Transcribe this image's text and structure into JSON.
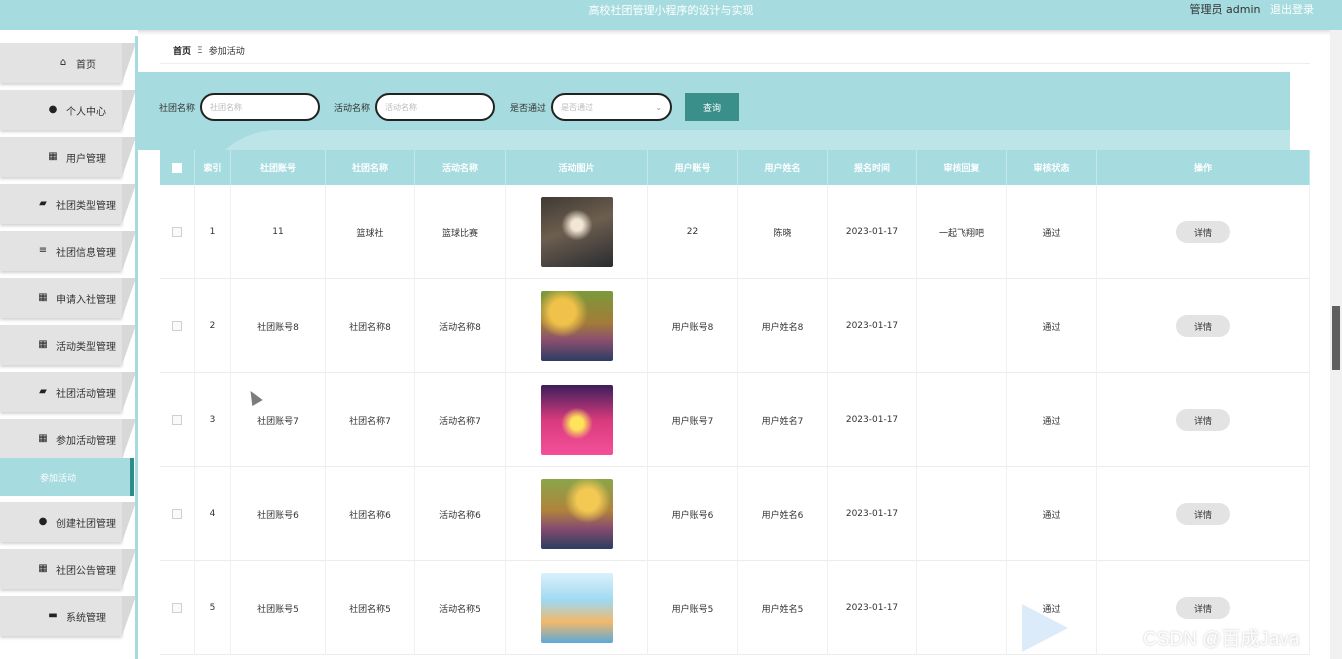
{
  "header": {
    "title": "高校社团管理小程序的设计与实现",
    "user_label": "管理员 admin",
    "logout_label": "退出登录"
  },
  "sidebar": {
    "items": [
      {
        "label": "首页",
        "icon": "home-icon"
      },
      {
        "label": "个人中心",
        "icon": "user-icon"
      },
      {
        "label": "用户管理",
        "icon": "grid-icon"
      },
      {
        "label": "社团类型管理",
        "icon": "briefcase-icon"
      },
      {
        "label": "社团信息管理",
        "icon": "list-icon"
      },
      {
        "label": "申请入社管理",
        "icon": "grid-icon"
      },
      {
        "label": "活动类型管理",
        "icon": "grid-icon"
      },
      {
        "label": "社团活动管理",
        "icon": "briefcase-icon"
      },
      {
        "label": "参加活动管理",
        "icon": "grid-icon"
      },
      {
        "label": "创建社团管理",
        "icon": "pin-icon"
      },
      {
        "label": "社团公告管理",
        "icon": "grid-icon"
      },
      {
        "label": "系统管理",
        "icon": "monitor-icon"
      }
    ],
    "active_sub": "参加活动"
  },
  "breadcrumb": {
    "home": "首页",
    "separator": "Ξ",
    "current": "参加活动"
  },
  "search": {
    "club_name_label": "社团名称",
    "club_name_placeholder": "社团名称",
    "activity_name_label": "活动名称",
    "activity_name_placeholder": "活动名称",
    "approved_label": "是否通过",
    "approved_placeholder": "是否通过",
    "query_button": "查询"
  },
  "table": {
    "columns": [
      "索引",
      "社团账号",
      "社团名称",
      "活动名称",
      "活动图片",
      "用户账号",
      "用户姓名",
      "报名时间",
      "审核回复",
      "审核状态",
      "操作"
    ],
    "rows": [
      {
        "index": "1",
        "club_account": "11",
        "club_name": "篮球社",
        "activity_name": "篮球比赛",
        "image": "basketball-photo",
        "user_account": "22",
        "user_name": "陈晓",
        "signup_time": "2023-01-17",
        "review_reply": "一起飞翔吧",
        "review_status": "通过",
        "action": "详情"
      },
      {
        "index": "2",
        "club_account": "社团账号8",
        "club_name": "社团名称8",
        "activity_name": "活动名称8",
        "image": "group-photo",
        "user_account": "用户账号8",
        "user_name": "用户姓名8",
        "signup_time": "2023-01-17",
        "review_reply": "",
        "review_status": "通过",
        "action": "详情"
      },
      {
        "index": "3",
        "club_account": "社团账号7",
        "club_name": "社团名称7",
        "activity_name": "活动名称7",
        "image": "stage-photo",
        "user_account": "用户账号7",
        "user_name": "用户姓名7",
        "signup_time": "2023-01-17",
        "review_reply": "",
        "review_status": "通过",
        "action": "详情"
      },
      {
        "index": "4",
        "club_account": "社团账号6",
        "club_name": "社团名称6",
        "activity_name": "活动名称6",
        "image": "group-photo",
        "user_account": "用户账号6",
        "user_name": "用户姓名6",
        "signup_time": "2023-01-17",
        "review_reply": "",
        "review_status": "通过",
        "action": "详情"
      },
      {
        "index": "5",
        "club_account": "社团账号5",
        "club_name": "社团名称5",
        "activity_name": "活动名称5",
        "image": "poster-photo",
        "user_account": "用户账号5",
        "user_name": "用户姓名5",
        "signup_time": "2023-01-17",
        "review_reply": "",
        "review_status": "通过",
        "action": "详情"
      }
    ]
  },
  "watermark": "CSDN @百成Java",
  "colors": {
    "accent": "#a6dbdf",
    "button": "#3a8f8b",
    "active_border": "#2e8b87"
  }
}
